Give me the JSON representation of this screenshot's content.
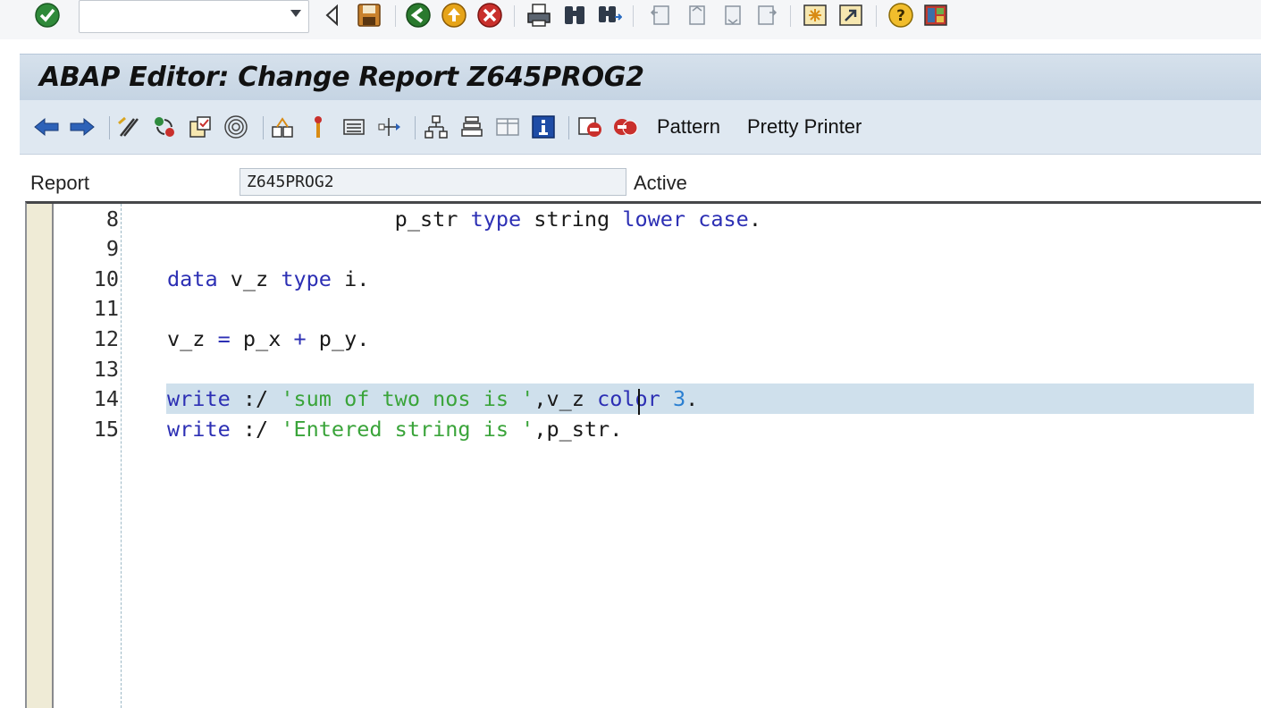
{
  "system_toolbar": {
    "command_field": {
      "value": "",
      "placeholder": ""
    },
    "icons": [
      "enter-icon",
      "back-icon",
      "save-icon",
      "back-green-icon",
      "exit-icon",
      "cancel-icon",
      "print-icon",
      "find-icon",
      "find-next-icon",
      "first-page-icon",
      "previous-page-icon",
      "next-page-icon",
      "last-page-icon",
      "create-session-icon",
      "shortcut-icon",
      "help-icon",
      "layout-icon"
    ]
  },
  "title": "ABAP Editor: Change Report Z645PROG2",
  "app_toolbar": {
    "pattern_label": "Pattern",
    "pretty_printer_label": "Pretty Printer"
  },
  "report": {
    "label": "Report",
    "value": "Z645PROG2",
    "status": "Active"
  },
  "editor": {
    "lines": [
      {
        "num": "8",
        "tokens": [
          {
            "t": "                  p_str ",
            "c": "p"
          },
          {
            "t": "type",
            "c": "k"
          },
          {
            "t": " string ",
            "c": "p"
          },
          {
            "t": "lower case",
            "c": "k"
          },
          {
            "t": ".",
            "c": "p"
          }
        ]
      },
      {
        "num": "9",
        "tokens": []
      },
      {
        "num": "10",
        "tokens": [
          {
            "t": "data",
            "c": "k"
          },
          {
            "t": " v_z ",
            "c": "p"
          },
          {
            "t": "type",
            "c": "k"
          },
          {
            "t": " i.",
            "c": "p"
          }
        ]
      },
      {
        "num": "11",
        "tokens": []
      },
      {
        "num": "12",
        "tokens": [
          {
            "t": "v_z ",
            "c": "p"
          },
          {
            "t": "=",
            "c": "k"
          },
          {
            "t": " p_x ",
            "c": "p"
          },
          {
            "t": "+",
            "c": "k"
          },
          {
            "t": " p_y.",
            "c": "p"
          }
        ]
      },
      {
        "num": "13",
        "tokens": []
      },
      {
        "num": "14",
        "highlight": true,
        "tokens": [
          {
            "t": "write",
            "c": "k"
          },
          {
            "t": " :/ ",
            "c": "p"
          },
          {
            "t": "'sum of two nos is '",
            "c": "s"
          },
          {
            "t": ",v_z ",
            "c": "p"
          },
          {
            "t": "color",
            "c": "k"
          },
          {
            "t": " ",
            "c": "p"
          },
          {
            "t": "3",
            "c": "n"
          },
          {
            "t": ".",
            "c": "p"
          }
        ]
      },
      {
        "num": "15",
        "tokens": [
          {
            "t": "write",
            "c": "k"
          },
          {
            "t": " :/ ",
            "c": "p"
          },
          {
            "t": "'Entered string is '",
            "c": "s"
          },
          {
            "t": ",p_str.",
            "c": "p"
          }
        ]
      }
    ]
  },
  "colors": {
    "keyword": "#2c2fb4",
    "string": "#3aa43a",
    "number": "#2a7fd1",
    "highlight": "#cfe0ec",
    "gutter": "#efebd6"
  }
}
